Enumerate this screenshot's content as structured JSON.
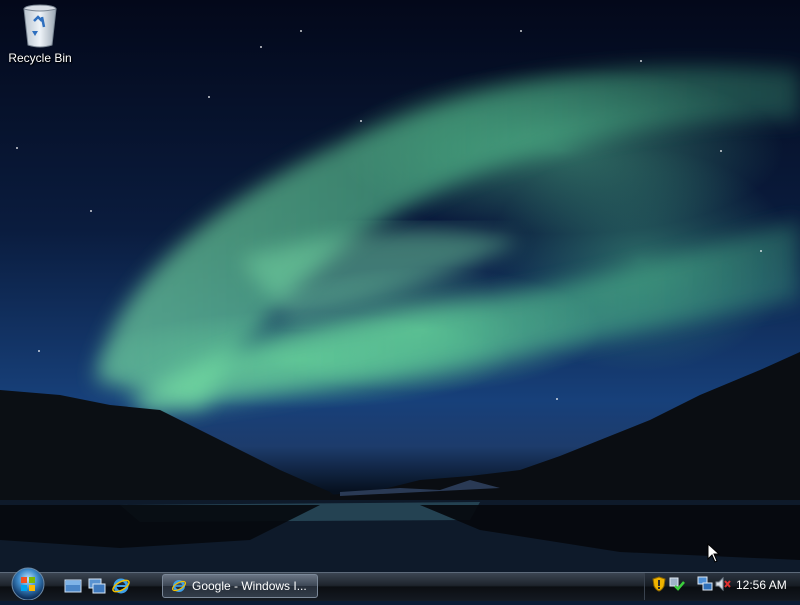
{
  "desktop": {
    "icons": [
      {
        "label": "Recycle Bin",
        "icon": "recycle-bin-icon"
      }
    ]
  },
  "taskbar": {
    "start_icon": "windows-orb-icon",
    "quick_launch": [
      {
        "icon": "show-desktop-icon"
      },
      {
        "icon": "switch-windows-icon"
      },
      {
        "icon": "internet-explorer-icon"
      }
    ],
    "tasks": [
      {
        "label": "Google - Windows I...",
        "icon": "internet-explorer-icon"
      }
    ],
    "tray": {
      "icons": [
        "security-shield-icon",
        "network-check-icon",
        "network-connection-icon",
        "volume-muted-icon"
      ],
      "clock": "12:56 AM"
    }
  },
  "colors": {
    "aurora": "#5fd89a",
    "sky": "#0a1c3e",
    "taskbar": "#141a22"
  }
}
